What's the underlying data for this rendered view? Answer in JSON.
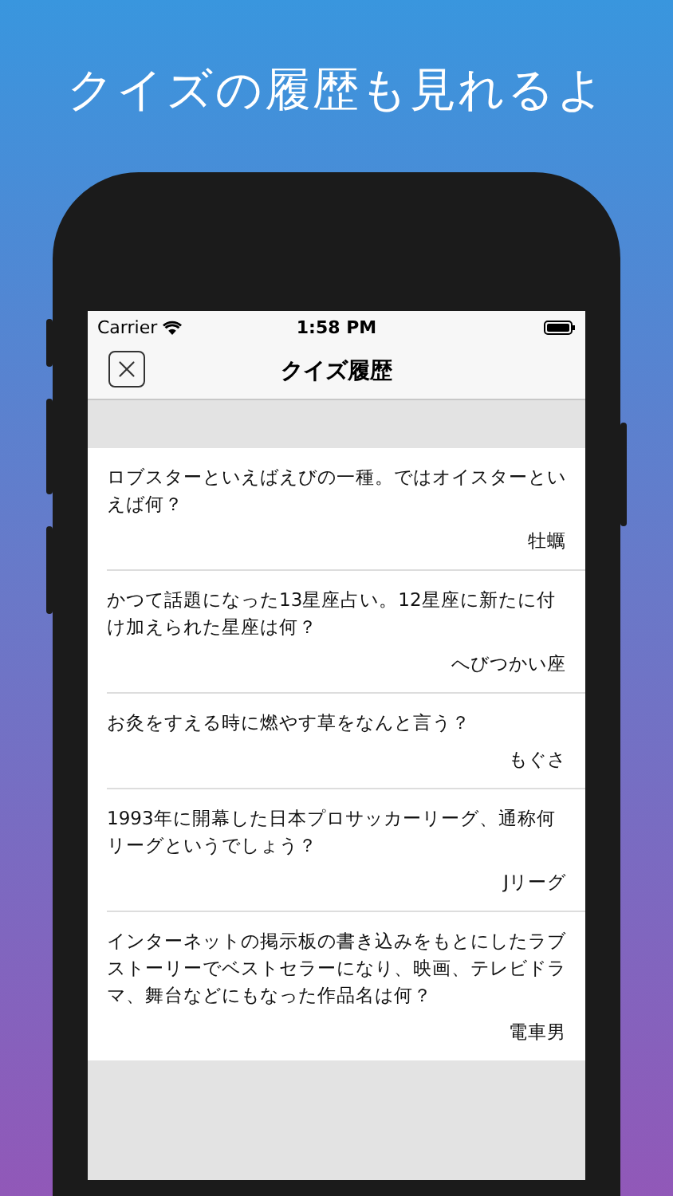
{
  "headline": "クイズの履歴も見れるよ",
  "status_bar": {
    "carrier": "Carrier",
    "time": "1:58 PM"
  },
  "nav": {
    "title": "クイズ履歴"
  },
  "history": [
    {
      "question": "ロブスターといえばえびの一種。ではオイスターといえば何？",
      "answer": "牡蠣"
    },
    {
      "question": "かつて話題になった13星座占い。12星座に新たに付け加えられた星座は何？",
      "answer": "へびつかい座"
    },
    {
      "question": "お灸をすえる時に燃やす草をなんと言う？",
      "answer": "もぐさ"
    },
    {
      "question": "1993年に開幕した日本プロサッカーリーグ、通称何リーグというでしょう？",
      "answer": "Jリーグ"
    },
    {
      "question": "インターネットの掲示板の書き込みをもとにしたラブストーリーでベストセラーになり、映画、テレビドラマ、舞台などにもなった作品名は何？",
      "answer": "電車男"
    }
  ]
}
